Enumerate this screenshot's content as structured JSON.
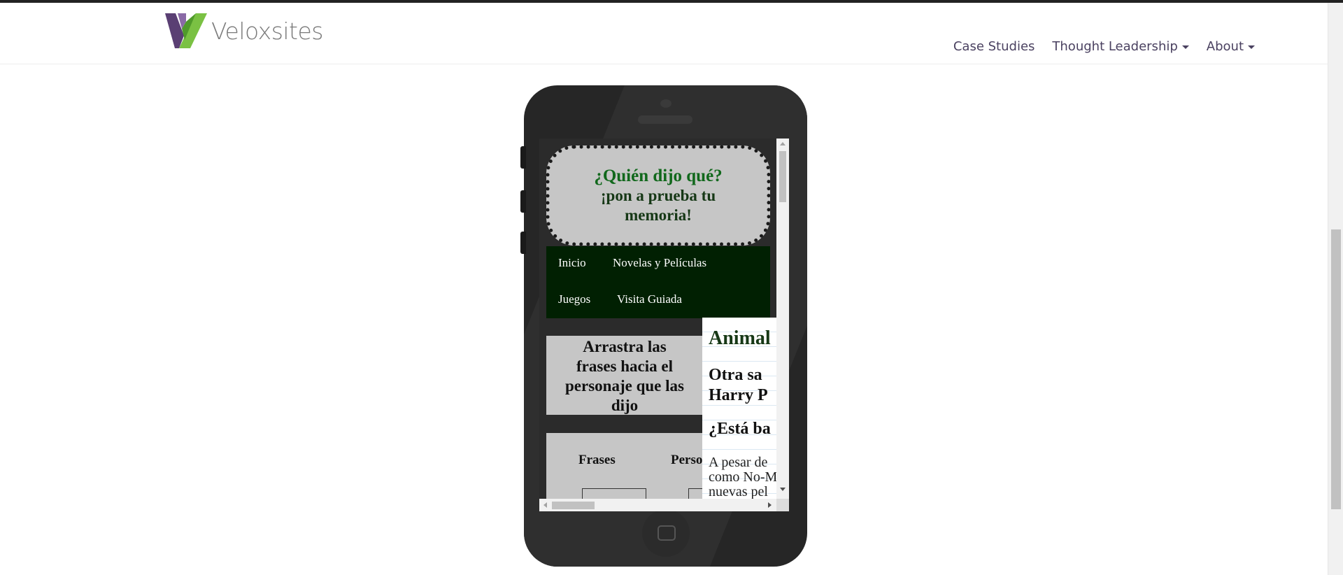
{
  "header": {
    "logo_text": "Veloxsites",
    "nav": [
      {
        "label": "Case Studies",
        "has_dropdown": false
      },
      {
        "label": "Thought Leadership",
        "has_dropdown": true
      },
      {
        "label": "About",
        "has_dropdown": true
      }
    ]
  },
  "colors": {
    "brand_purple": "#5a3f73",
    "brand_green": "#7ac143",
    "nav_text": "#4a4160",
    "banner_title_green": "#11681c",
    "menu_bg": "#012002"
  },
  "phone_page": {
    "banner": {
      "title": "¿Quién dijo qué?",
      "subtitle_line1": "¡pon a prueba tu",
      "subtitle_line2": "memoria!"
    },
    "menu": [
      "Inicio",
      "Novelas y Películas",
      "Juegos",
      "Visita Guiada"
    ],
    "drag_instruction": {
      "line1": "Arrastra las",
      "line2": "frases hacia el",
      "line3": "personaje que las",
      "line4": "dijo"
    },
    "game": {
      "col_phrases": "Frases",
      "col_characters": "Perso"
    },
    "article": {
      "heading1": "Animal",
      "heading2_line1": "Otra  sa",
      "heading2_line2": "Harry P",
      "heading3": "¿Está ba",
      "para_line1": "A  pesar  de",
      "para_line2": "como  No-M",
      "para_line3": "nuevas  pel"
    }
  }
}
